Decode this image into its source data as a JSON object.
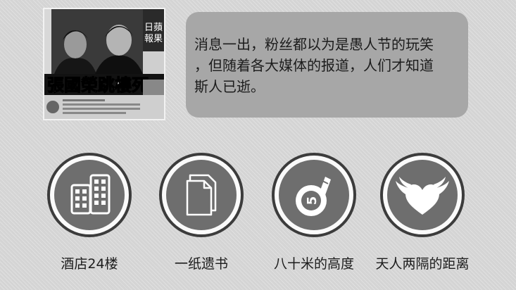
{
  "newspaper": {
    "masthead": "日蘋\n報果",
    "headline": "張國榮跳樓死"
  },
  "caption": "消息一出，粉丝都以为是愚人节的玩笑\n，但随着各大媒体的报道，人们才知道\n斯人已逝。",
  "items": [
    {
      "label": "酒店24楼",
      "icon": "building-icon"
    },
    {
      "label": "一纸遗书",
      "icon": "document-icon"
    },
    {
      "label": "八十米的高度",
      "icon": "tape-measure-icon",
      "icon_text": "5"
    },
    {
      "label": "天人两隔的距离",
      "icon": "winged-heart-icon"
    }
  ],
  "colors": {
    "background": "#d4d4d4",
    "bubble": "#a7a7a7",
    "ring_border": "#3c3c3c",
    "icon_disc": "#6e6e6e",
    "icon_fill": "#ffffff"
  }
}
